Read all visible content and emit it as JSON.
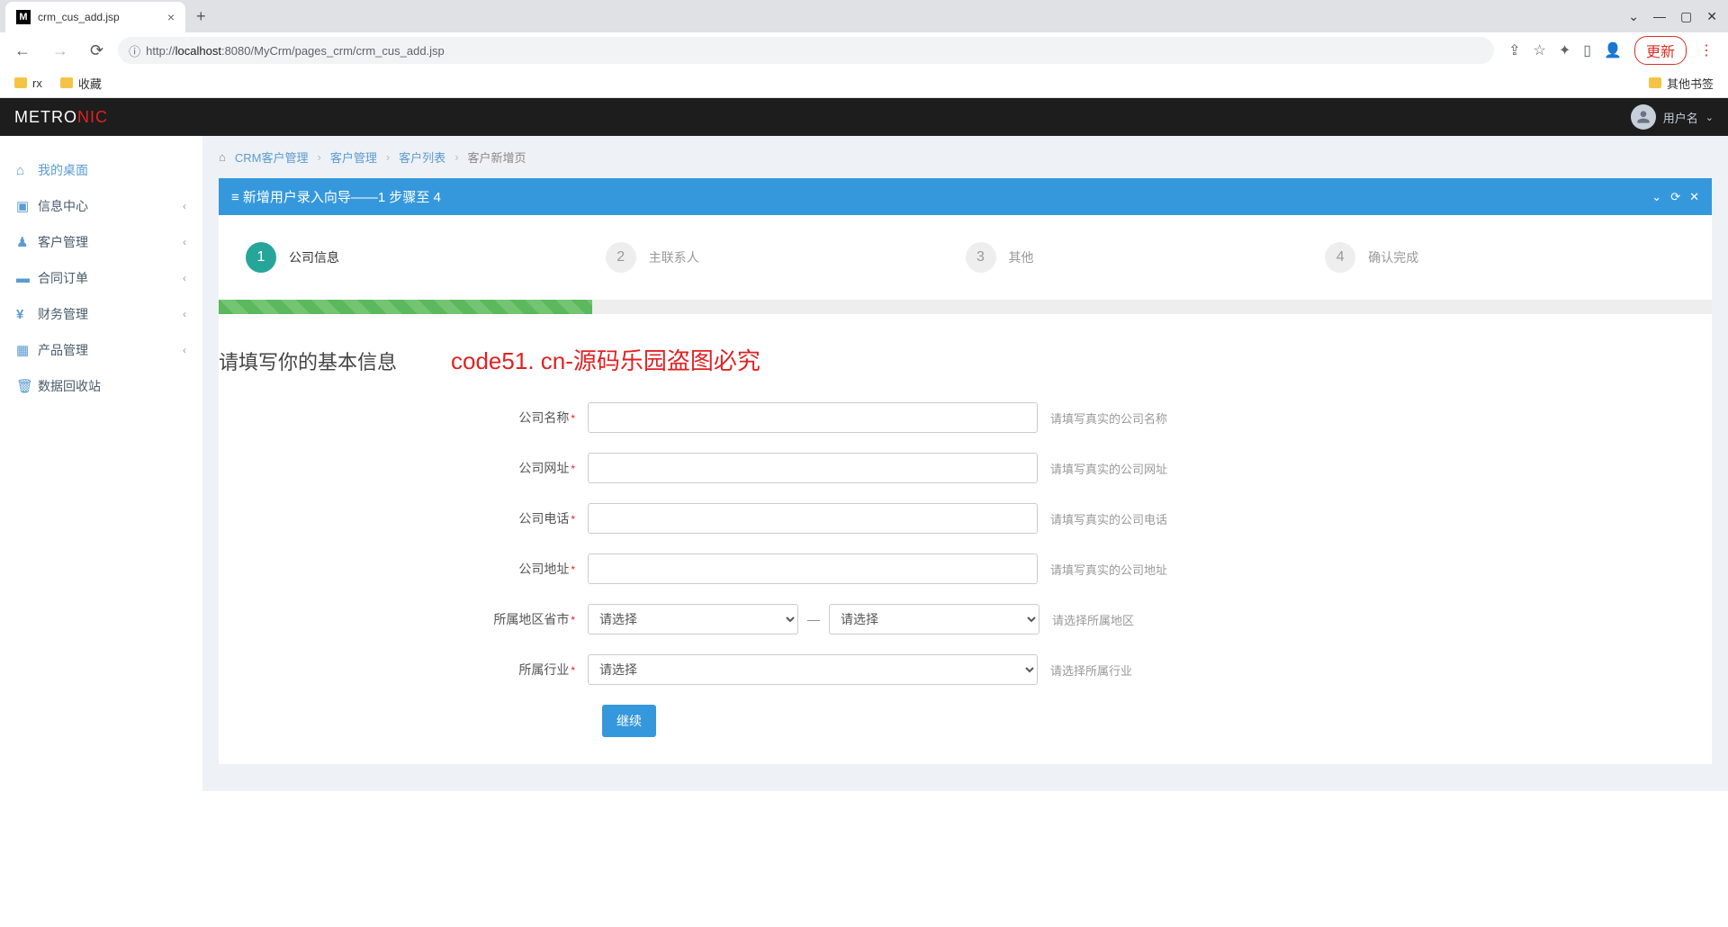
{
  "browser": {
    "tab_title": "crm_cus_add.jsp",
    "tab_favicon": "M",
    "url_prefix": "http://",
    "url_host": "localhost",
    "url_port": ":8080",
    "url_path": "/MyCrm/pages_crm/crm_cus_add.jsp",
    "update_btn": "更新",
    "bookmarks": {
      "rx": "rx",
      "fav": "收藏",
      "other": "其他书签"
    }
  },
  "header": {
    "logo_main": "METRO",
    "logo_accent": "NIC",
    "username": "用户名"
  },
  "sidebar": {
    "items": [
      {
        "icon": "home-icon",
        "label": "我的桌面",
        "has_child": false
      },
      {
        "icon": "info-icon",
        "label": "信息中心",
        "has_child": true
      },
      {
        "icon": "user-icon",
        "label": "客户管理",
        "has_child": true
      },
      {
        "icon": "book-icon",
        "label": "合同订单",
        "has_child": true
      },
      {
        "icon": "yen-icon",
        "label": "财务管理",
        "has_child": true
      },
      {
        "icon": "grid-icon",
        "label": "产品管理",
        "has_child": true
      },
      {
        "icon": "trash-icon",
        "label": "数据回收站",
        "has_child": false
      }
    ]
  },
  "breadcrumb": {
    "items": [
      "CRM客户管理",
      "客户管理",
      "客户列表",
      "客户新增页"
    ]
  },
  "portlet": {
    "title": "≡ 新增用户录入向导——1 步骤至 4"
  },
  "wizard": {
    "steps": [
      {
        "num": "1",
        "label": "公司信息"
      },
      {
        "num": "2",
        "label": "主联系人"
      },
      {
        "num": "3",
        "label": "其他"
      },
      {
        "num": "4",
        "label": "确认完成"
      }
    ],
    "active_step": 1,
    "progress_pct": 25
  },
  "form": {
    "heading": "请填写你的基本信息",
    "watermark": "code51. cn-源码乐园盗图必究",
    "fields": {
      "company_name": {
        "label": "公司名称",
        "help": "请填写真实的公司名称",
        "value": ""
      },
      "company_url": {
        "label": "公司网址",
        "help": "请填写真实的公司网址",
        "value": ""
      },
      "company_phone": {
        "label": "公司电话",
        "help": "请填写真实的公司电话",
        "value": ""
      },
      "company_addr": {
        "label": "公司地址",
        "help": "请填写真实的公司地址",
        "value": ""
      },
      "region": {
        "label": "所属地区省市",
        "help": "请选择所属地区",
        "select1": "请选择",
        "select2": "请选择"
      },
      "industry": {
        "label": "所属行业",
        "help": "请选择所属行业",
        "select": "请选择"
      }
    },
    "submit_btn": "继续"
  },
  "icons": {
    "home": "⌂",
    "info": "▣",
    "user": "👤",
    "book": "📕",
    "yen": "¥",
    "grid": "▦",
    "trash": "🗑"
  }
}
